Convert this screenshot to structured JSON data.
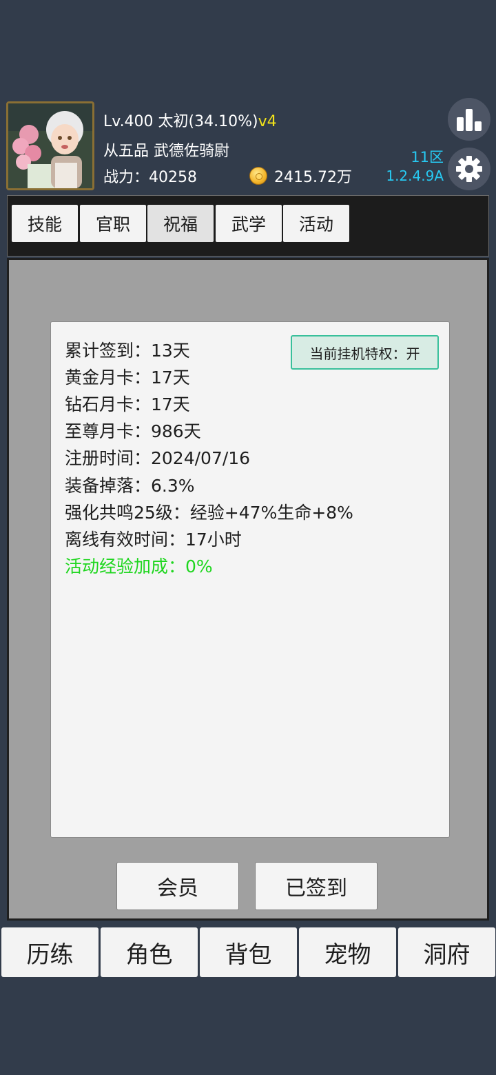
{
  "player": {
    "level_text": "Lv.400 太初(34.10%)",
    "version_badge": "v4",
    "rank_title": "从五品 武德佐骑尉",
    "power_text": "战力：40258",
    "coins_text": "2415.72万"
  },
  "server": {
    "zone": "11区",
    "version": "1.2.4.9A"
  },
  "icons": {
    "rank": "bar-chart-icon",
    "settings": "gear-icon",
    "coin": "gold-coin-icon"
  },
  "tabs": [
    {
      "label": "技能"
    },
    {
      "label": "官职"
    },
    {
      "label": "祝福"
    },
    {
      "label": "武学"
    },
    {
      "label": "活动"
    }
  ],
  "active_tab": "祝福",
  "info": {
    "checkin": "累计签到：13天",
    "gold_card": "黄金月卡：17天",
    "diamond_card": "钻石月卡：17天",
    "supreme_card": "至尊月卡：986天",
    "register_time": "注册时间：2024/07/16",
    "drop_rate": "装备掉落：6.3%",
    "resonance": "强化共鸣25级：经验+47%生命+8%",
    "offline_time": "离线有效时间：17小时",
    "event_bonus": "活动经验加成：0%",
    "privilege": "当前挂机特权：开"
  },
  "actions": {
    "member": "会员",
    "signed": "已签到"
  },
  "nav": [
    {
      "label": "历练"
    },
    {
      "label": "角色"
    },
    {
      "label": "背包"
    },
    {
      "label": "宠物"
    },
    {
      "label": "洞府"
    }
  ],
  "colors": {
    "background": "#323c4b",
    "accent_cyan": "#27c9f2",
    "version_yellow": "#f1e21a",
    "bonus_green": "#1ed61e",
    "privilege_border": "#39c09b"
  }
}
